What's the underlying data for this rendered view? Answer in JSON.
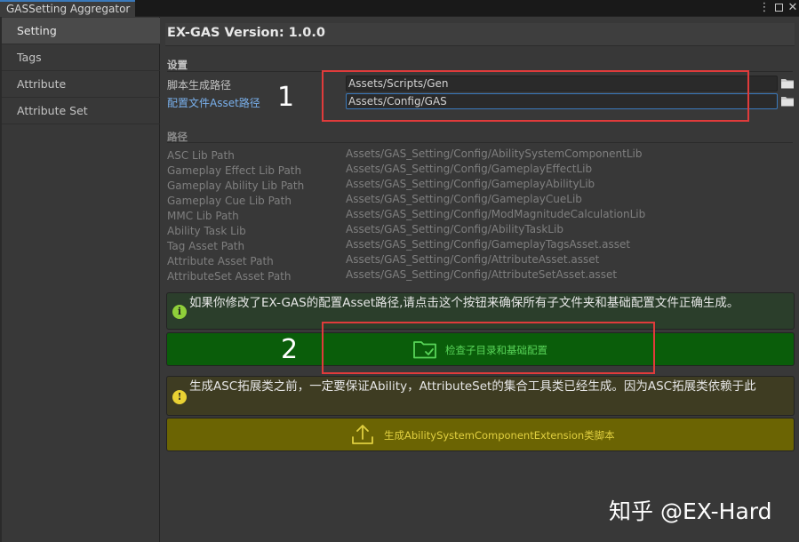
{
  "window": {
    "tab_title": "GASSetting Aggregator",
    "menu_icon": "kebab-menu-icon",
    "maximize_icon": "maximize-icon",
    "close_icon": "close-icon"
  },
  "sidebar": {
    "items": [
      {
        "label": "Setting",
        "active": true
      },
      {
        "label": "Tags",
        "active": false
      },
      {
        "label": "Attribute",
        "active": false
      },
      {
        "label": "Attribute Set",
        "active": false
      }
    ]
  },
  "main": {
    "version_title": "EX-GAS Version: 1.0.0",
    "settings_section": {
      "heading": "设置",
      "script_gen_path": {
        "label": "脚本生成路径",
        "value": "Assets/Scripts/Gen"
      },
      "config_asset_path": {
        "label": "配置文件Asset路径",
        "value": "Assets/Config/GAS"
      }
    },
    "paths_section": {
      "heading": "路径",
      "rows": [
        {
          "label": "ASC Lib Path",
          "value": "Assets/GAS_Setting/Config/AbilitySystemComponentLib"
        },
        {
          "label": "Gameplay Effect Lib Path",
          "value": "Assets/GAS_Setting/Config/GameplayEffectLib"
        },
        {
          "label": "Gameplay Ability Lib Path",
          "value": "Assets/GAS_Setting/Config/GameplayAbilityLib"
        },
        {
          "label": "Gameplay Cue Lib Path",
          "value": "Assets/GAS_Setting/Config/GameplayCueLib"
        },
        {
          "label": "MMC Lib Path",
          "value": "Assets/GAS_Setting/Config/ModMagnitudeCalculationLib"
        },
        {
          "label": "Ability Task Lib",
          "value": "Assets/GAS_Setting/Config/AbilityTaskLib"
        },
        {
          "label": "Tag Asset Path",
          "value": "Assets/GAS_Setting/Config/GameplayTagsAsset.asset"
        },
        {
          "label": "Attribute Asset Path",
          "value": "Assets/GAS_Setting/Config/AttributeAsset.asset"
        },
        {
          "label": "AttributeSet Asset Path",
          "value": "Assets/GAS_Setting/Config/AttributeSetAsset.asset"
        }
      ]
    },
    "help_info": "如果你修改了EX-GAS的配置Asset路径,请点击这个按钮来确保所有子文件夹和基础配置文件正确生成。",
    "check_button_label": "检查子目录和基础配置",
    "help_warning": "生成ASC拓展类之前，一定要保证Ability，AttributeSet的集合工具类已经生成。因为ASC拓展类依赖于此",
    "generate_button_label": "生成AbilitySystemComponentExtension类脚本"
  },
  "annotations": {
    "marker_1": "1",
    "marker_2": "2"
  },
  "watermark": "知乎 @EX-Hard",
  "colors": {
    "background": "#383838",
    "accent_blue": "#3a79bb",
    "link_blue": "#79b0ec",
    "green_button": "#0a5d0a",
    "yellow_button": "#6b6403",
    "annotation_red": "#e03b3b"
  }
}
